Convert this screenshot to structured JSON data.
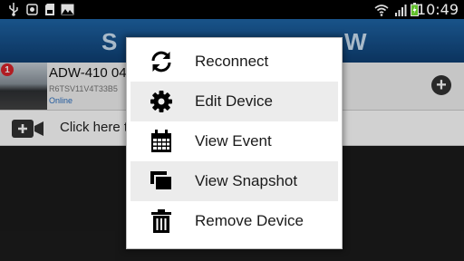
{
  "status_bar": {
    "time": "10:49",
    "icons": [
      "usb-icon",
      "gallery-icon",
      "sd-card-icon",
      "image-icon",
      "wifi-icon",
      "signal-icon",
      "battery-icon"
    ]
  },
  "header": {
    "brand_fragment_left": "S",
    "brand_fragment_right": "W"
  },
  "device": {
    "badge_count": "1",
    "name": "ADW-410 04",
    "id": "R6TSV11V4T33B5",
    "status": "Online"
  },
  "add_device": {
    "label": "Click here t"
  },
  "menu": {
    "items": [
      {
        "label": "Reconnect",
        "icon": "refresh-icon"
      },
      {
        "label": "Edit Device",
        "icon": "gear-icon"
      },
      {
        "label": "View Event",
        "icon": "calendar-icon"
      },
      {
        "label": "View Snapshot",
        "icon": "snapshot-icon"
      },
      {
        "label": "Remove Device",
        "icon": "trash-icon"
      }
    ]
  },
  "colors": {
    "header_top": "#1f66a8",
    "header_bottom": "#0e3f73",
    "status_link": "#2a6fc1",
    "badge": "#d8232a",
    "battery": "#5fbf2a",
    "menu_shade": "#ececec"
  }
}
